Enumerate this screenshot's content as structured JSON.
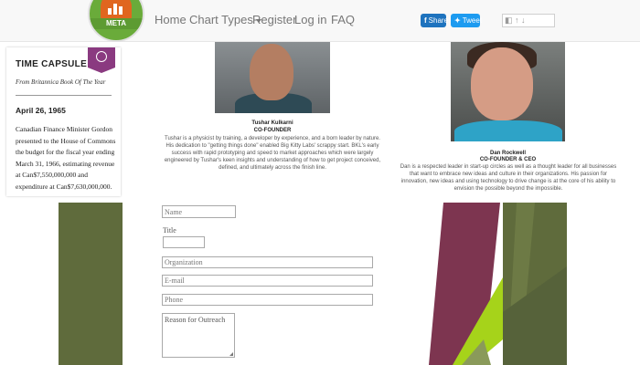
{
  "nav": {
    "logo_text": "META",
    "items": [
      {
        "label": "Home"
      },
      {
        "label": "Chart Types"
      },
      {
        "label": "Register"
      },
      {
        "label": "Log in"
      },
      {
        "label": "FAQ"
      }
    ],
    "share": {
      "facebook_label": "Share",
      "twitter_label": "Tweet"
    }
  },
  "capsule": {
    "title": "TIME CAPSULE",
    "subtitle": "From Britannica Book Of The Year",
    "date": "April 26, 1965",
    "text": "Canadian Finance Minister Gordon presented to the House of Commons the budget for the fiscal year ending March 31, 1966, estimating revenue at Can$7,550,000,000 and expenditure at Can$7,630,000,000."
  },
  "profiles": [
    {
      "name": "Tushar Kulkarni",
      "role": "CO-FOUNDER",
      "bio": "Tushar is a physicist by training, a developer by experience, and a born leader by nature. His dedication to \"getting things done\" enabled Big Kitty Labs' scrappy start. BKL's early success with rapid prototyping and speed to market approaches which were largely engineered by Tushar's keen insights and understanding of how to get project conceived, defined, and ultimately across the finish line."
    },
    {
      "name": "Dan Rockwell",
      "role": "CO-FOUNDER & CEO",
      "bio": "Dan is a respected leader in start-up circles as well as a thought leader for all businesses that want to embrace new ideas and culture in their organizations. His passion for innovation, new ideas and using technology to drive change is at the core of his ability to envision the possible beyond the impossible."
    }
  ],
  "form": {
    "name_placeholder": "Name",
    "title_label": "Title",
    "organization_placeholder": "Organization",
    "email_placeholder": "E-mail",
    "phone_placeholder": "Phone",
    "reason_placeholder": "Reason for Outreach"
  },
  "colors": {
    "panel_olive": "#5f6b3c",
    "accent_purple": "#8a3a80",
    "accent_green": "#a6d31a",
    "accent_plum": "#7d3550"
  }
}
